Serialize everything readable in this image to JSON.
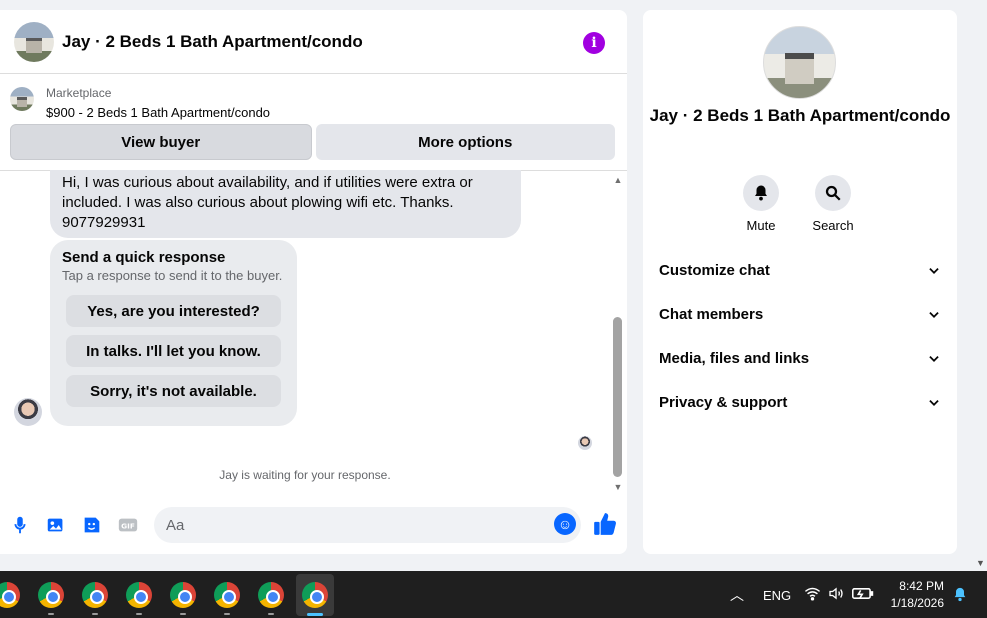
{
  "header": {
    "title": "Jay · 2 Beds 1 Bath Apartment/condo",
    "info_label": "i"
  },
  "listing": {
    "source": "Marketplace",
    "title": "$900 - 2 Beds 1 Bath Apartment/condo"
  },
  "actions": {
    "view_buyer": "View buyer",
    "more_options": "More options"
  },
  "message": {
    "text": "Hi, I was curious about availability, and if utilities were extra or included. I was also curious about plowing wifi etc. Thanks. 9077929931"
  },
  "quick_response": {
    "title": "Send a quick response",
    "subtitle": "Tap a response to send it to the buyer.",
    "options": [
      "Yes, are you interested?",
      "In talks. I'll let you know.",
      "Sorry, it's not available."
    ]
  },
  "status": {
    "waiting": "Jay is waiting for your response."
  },
  "composer": {
    "placeholder": "Aa"
  },
  "profile": {
    "title": "Jay · 2 Beds 1 Bath Apartment/condo",
    "mute_label": "Mute",
    "search_label": "Search",
    "sections": [
      "Customize chat",
      "Chat members",
      "Media, files and links",
      "Privacy & support"
    ]
  },
  "taskbar": {
    "language": "ENG",
    "time": "8:42 PM",
    "date": "1/18/2026"
  },
  "colors": {
    "accent": "#0866ff",
    "info": "#a100e0"
  }
}
